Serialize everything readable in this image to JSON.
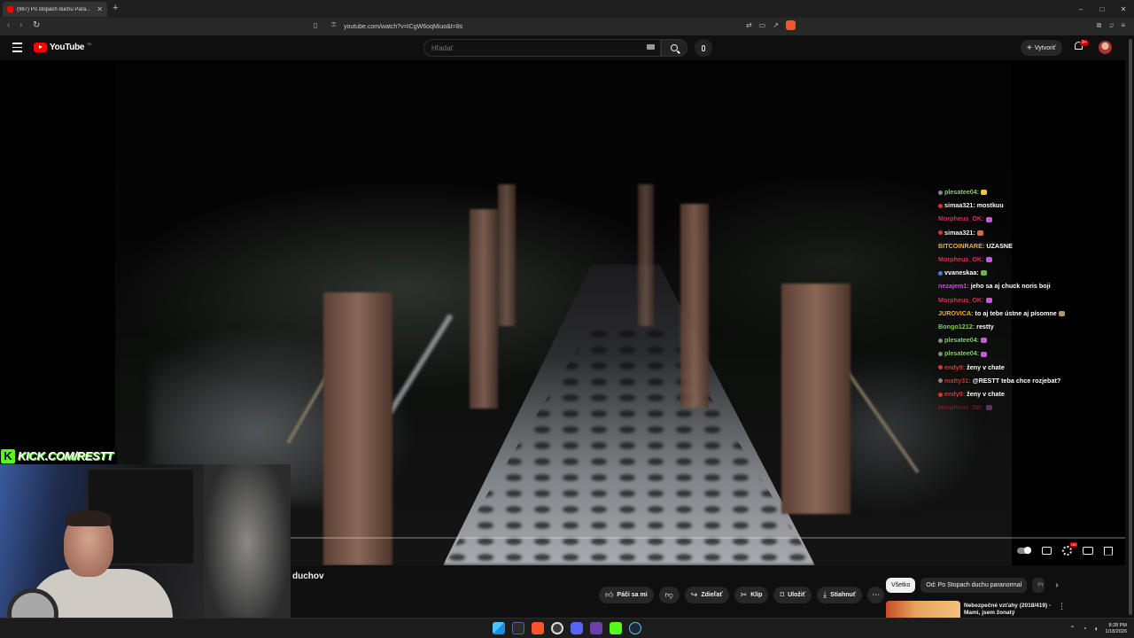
{
  "browser": {
    "tab_title": "(987) Po stopach duchu Para...",
    "url": "youtube.com/watch?v=ICgW6oqMiuo&t=8s",
    "window_controls": [
      "–",
      "□",
      "✕"
    ]
  },
  "youtube": {
    "logo": "YouTube",
    "country_code": "SK",
    "search_placeholder": "Hľadať",
    "create_label": "Vytvoriť",
    "notif_count": "9+"
  },
  "overlay": {
    "kick_text": "KICK.COM/RESTT"
  },
  "chat": [
    {
      "user": "plesatee04:",
      "msg": "",
      "color": "#7dd65b",
      "dot": "#888",
      "emote": "#e8c840"
    },
    {
      "user": "simaa321:",
      "msg": "mostkuu",
      "color": "#f4f4f4",
      "dot": "#e03030",
      "emote": ""
    },
    {
      "user": "Morpheus_OK:",
      "msg": "",
      "color": "#d6345a",
      "dot": "",
      "emote": "#c45ad6"
    },
    {
      "user": "simaa321:",
      "msg": "",
      "color": "#f4f4f4",
      "dot": "#e03030",
      "emote": "#d46b4a"
    },
    {
      "user": "BITCOINRARE:",
      "msg": "UZASNE",
      "color": "#e8b935",
      "dot": "",
      "emote": ""
    },
    {
      "user": "Morpheus_OK:",
      "msg": "",
      "color": "#d6345a",
      "dot": "",
      "emote": "#c45ad6"
    },
    {
      "user": "vvaneskaa:",
      "msg": "",
      "color": "#ffffff",
      "dot": "#3d7fe0",
      "emote": "#6fb34a"
    },
    {
      "user": "nezajem1:",
      "msg": "jeho sa aj chuck noris boji",
      "color": "#c85ad8",
      "dot": "",
      "emote": ""
    },
    {
      "user": "Morpheus_OK:",
      "msg": "",
      "color": "#d6345a",
      "dot": "",
      "emote": "#c45ad6"
    },
    {
      "user": "JUROVICA:",
      "msg": "to aj tebe ústne aj písomne",
      "color": "#e8b935",
      "dot": "",
      "emote": "#b09a70"
    },
    {
      "user": "Bongo1212:",
      "msg": "restty",
      "color": "#7dd65b",
      "dot": "",
      "emote": ""
    },
    {
      "user": "plesatee04:",
      "msg": "",
      "color": "#7dd65b",
      "dot": "#888",
      "emote": "#c45ad6"
    },
    {
      "user": "plesatee04:",
      "msg": "",
      "color": "#7dd65b",
      "dot": "#888",
      "emote": "#c45ad6"
    },
    {
      "user": "endy9:",
      "msg": "ženy v chate",
      "color": "#e23a3a",
      "dot": "#e03030",
      "emote": ""
    },
    {
      "user": "matty31:",
      "msg": "@RESTT teba chce rozjebat?",
      "color": "#c83a3a",
      "dot": "#888",
      "emote": ""
    },
    {
      "user": "endy9:",
      "msg": "ženy v chate",
      "color": "#e23a3a",
      "dot": "#e03030",
      "emote": ""
    },
    {
      "user": "Morpheus_OK:",
      "msg": "",
      "color": "#a12a44",
      "dot": "",
      "emote": "#8a4aa0"
    }
  ],
  "video": {
    "title_fragment": "duchov"
  },
  "actions": {
    "like": "Páči sa mi",
    "share": "Zdieľať",
    "clip": "Klip",
    "save": "Uložiť",
    "download": "Stiahnuť"
  },
  "chips": {
    "all": "Všetko",
    "from": "Od: Po Stopach duchu paranormal",
    "cut": "Pr"
  },
  "recommendation": {
    "title": "Nebezpečné vzťahy (2018/419) - Mami, jsem žonatý"
  },
  "taskbar": {
    "time": "8:28 PM",
    "date": "1/18/2026"
  }
}
